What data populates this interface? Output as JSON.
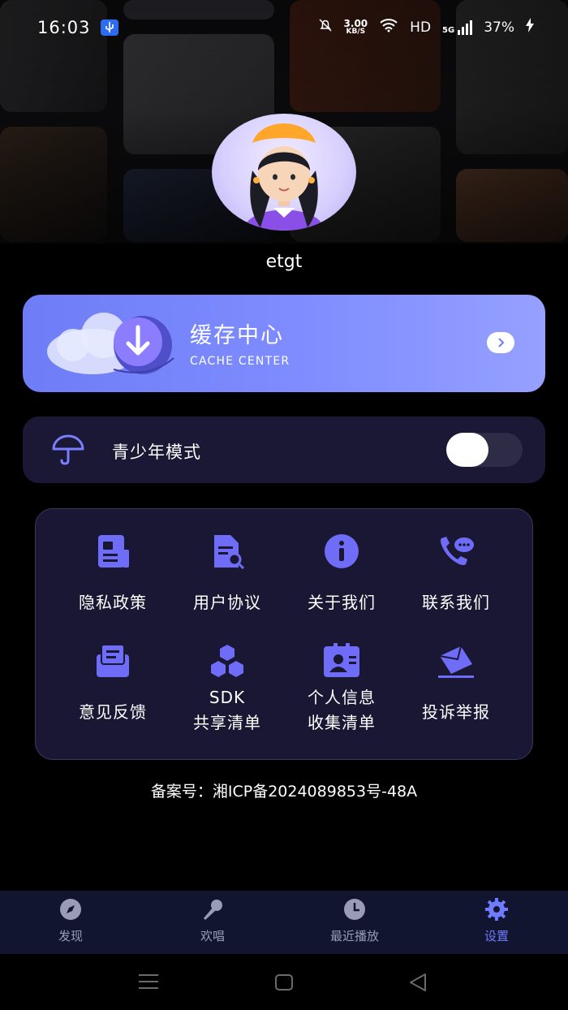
{
  "status_bar": {
    "time": "16:03",
    "net_speed_value": "3.00",
    "net_speed_unit": "KB/S",
    "hd": "HD",
    "signal": "5G",
    "battery": "37%"
  },
  "profile": {
    "username": "etgt"
  },
  "cache_card": {
    "title": "缓存中心",
    "subtitle": "CACHE CENTER"
  },
  "teen_mode": {
    "label": "青少年模式",
    "enabled": false
  },
  "grid": {
    "items": [
      {
        "label": "隐私政策",
        "icon": "privacy-policy-icon"
      },
      {
        "label": "用户协议",
        "icon": "user-agreement-icon"
      },
      {
        "label": "关于我们",
        "icon": "info-icon"
      },
      {
        "label": "联系我们",
        "icon": "contact-phone-icon"
      },
      {
        "label": "意见反馈",
        "icon": "feedback-icon"
      },
      {
        "label_line1": "SDK",
        "label_line2": "共享清单",
        "icon": "sdk-cubes-icon"
      },
      {
        "label_line1": "个人信息",
        "label_line2": "收集清单",
        "icon": "personal-info-icon"
      },
      {
        "label": "投诉举报",
        "icon": "complaint-mail-icon"
      }
    ]
  },
  "icp": "备案号：湘ICP备2024089853号-48A",
  "tabbar": {
    "tabs": [
      {
        "label": "发现",
        "icon": "compass-icon"
      },
      {
        "label": "欢唱",
        "icon": "microphone-icon"
      },
      {
        "label": "最近播放",
        "icon": "clock-icon"
      },
      {
        "label": "设置",
        "icon": "gear-icon",
        "active": true
      }
    ]
  },
  "colors": {
    "accent": "#6f7cff",
    "card_bg": "#1b1836",
    "cache_gradient_start": "#6e7df6",
    "cache_gradient_end": "#96a0ff"
  }
}
